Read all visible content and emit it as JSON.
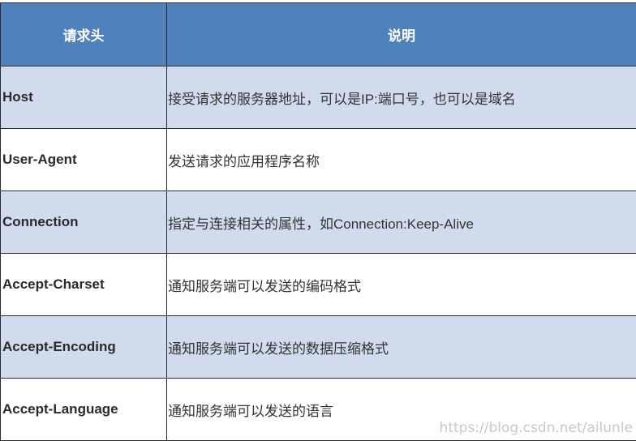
{
  "table": {
    "headers": [
      "请求头",
      "说明"
    ],
    "rows": [
      {
        "name": "Host",
        "desc": "接受请求的服务器地址，可以是IP:端口号，也可以是域名"
      },
      {
        "name": "User-Agent",
        "desc": "发送请求的应用程序名称"
      },
      {
        "name": "Connection",
        "desc": "指定与连接相关的属性，如Connection:Keep-Alive"
      },
      {
        "name": "Accept-Charset",
        "desc": "通知服务端可以发送的编码格式"
      },
      {
        "name": "Accept-Encoding",
        "desc": "通知服务端可以发送的数据压缩格式"
      },
      {
        "name": "Accept-Language",
        "desc": "通知服务端可以发送的语言"
      }
    ]
  },
  "watermark": "https://blog.csdn.net/ailunle",
  "colors": {
    "header_bg": "#4f81bd",
    "row_alt_bg": "#d0dcee",
    "border": "#2b2b2b"
  }
}
